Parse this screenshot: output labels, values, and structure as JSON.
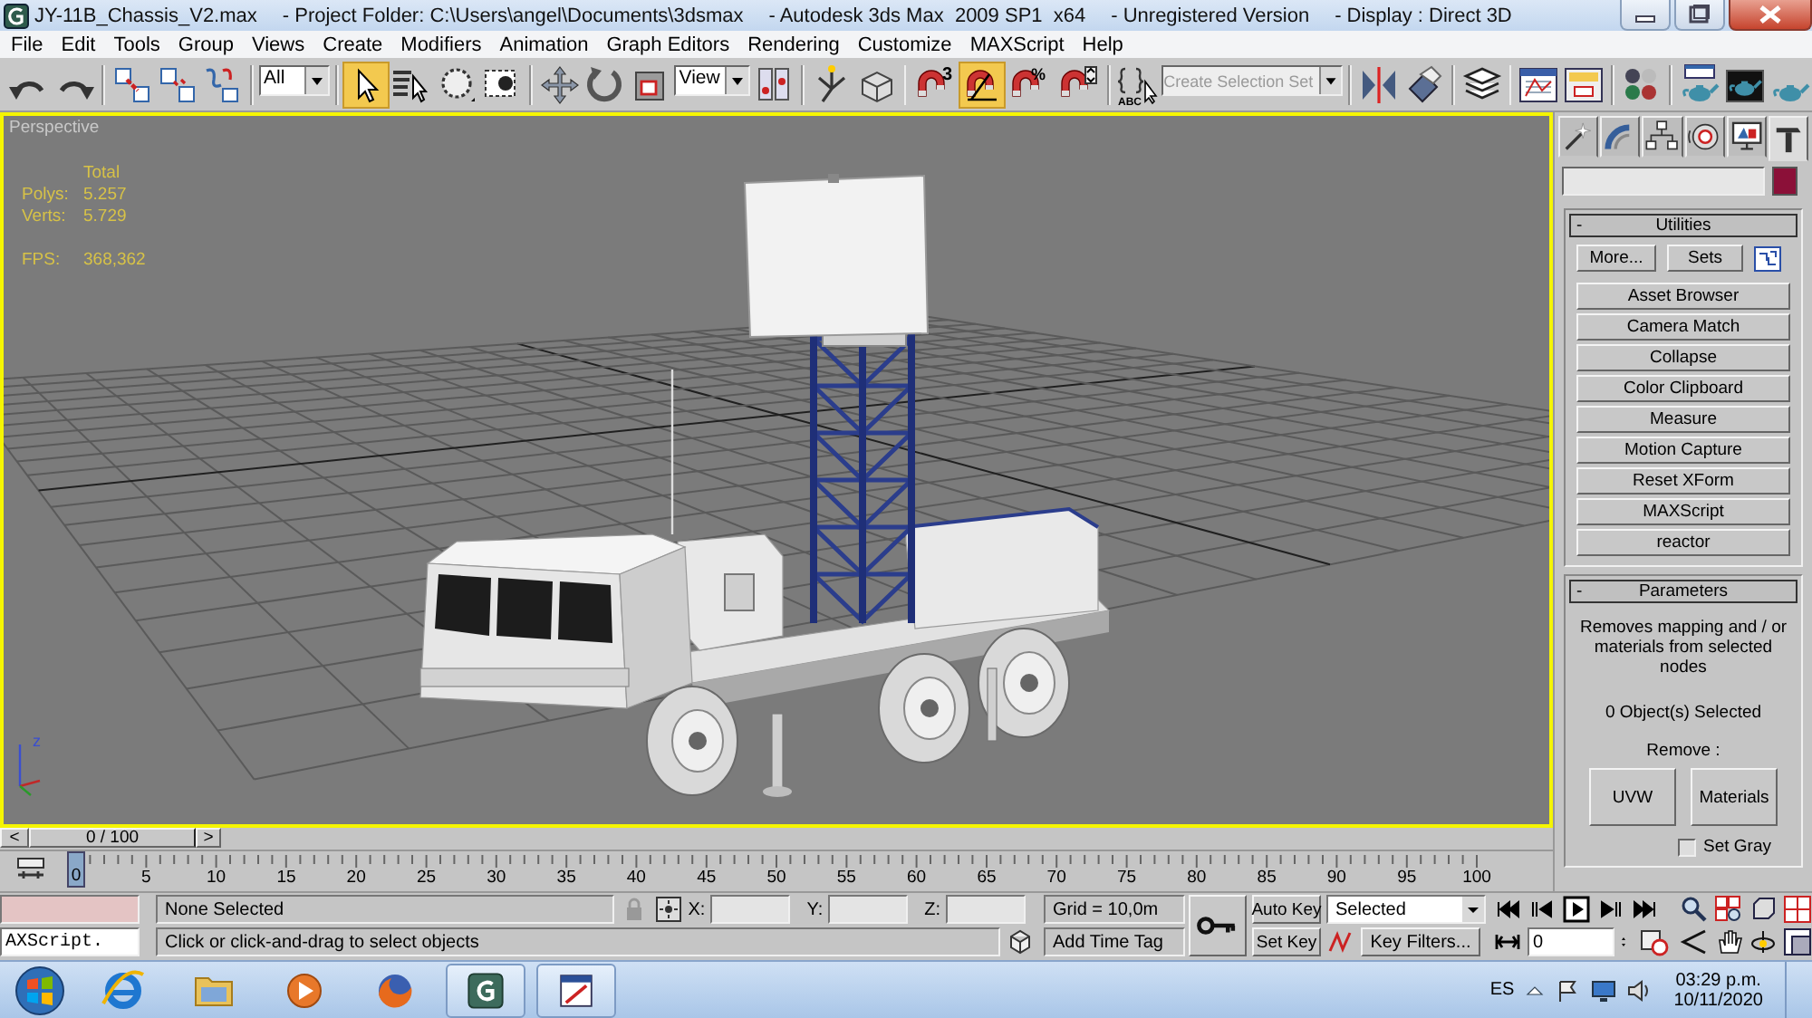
{
  "window": {
    "title_parts": [
      "JY-11B_Chassis_V2.max",
      "- Project Folder: C:\\Users\\angel\\Documents\\3dsmax",
      "- Autodesk 3ds Max  2009 SP1  x64",
      "- Unregistered Version",
      "- Display : Direct 3D"
    ]
  },
  "menu": [
    "File",
    "Edit",
    "Tools",
    "Group",
    "Views",
    "Create",
    "Modifiers",
    "Animation",
    "Graph Editors",
    "Rendering",
    "Customize",
    "MAXScript",
    "Help"
  ],
  "toolbar": {
    "selection_filter": "All",
    "select_object_on": true,
    "reference_coordinate_system": "View",
    "snap_dimension": "3",
    "angle_snap_on": true,
    "percent_label": "%",
    "named_sets_caption": "ABC",
    "named_selection_placeholder": "Create Selection Set"
  },
  "viewport": {
    "label": "Perspective",
    "active": true,
    "stats_heading": "Total",
    "stats": [
      {
        "label": "Polys:",
        "value": "5.257"
      },
      {
        "label": "Verts:",
        "value": "5.729"
      }
    ],
    "fps": {
      "label": "FPS:",
      "value": "368,362"
    },
    "axis_label": "z"
  },
  "command_panel": {
    "tabs": [
      {
        "selected": false
      },
      {
        "selected": false
      },
      {
        "selected": false
      },
      {
        "selected": false
      },
      {
        "selected": false
      },
      {
        "selected": true
      }
    ],
    "utilities": {
      "toggle": "-",
      "title": "Utilities",
      "top_buttons": [
        "More...",
        "Sets"
      ],
      "buttons": [
        "Asset Browser",
        "Camera Match",
        "Collapse",
        "Color Clipboard",
        "Measure",
        "Motion Capture",
        "Reset XForm",
        "MAXScript",
        "reactor"
      ]
    },
    "parameters": {
      "toggle": "-",
      "title": "Parameters",
      "description": "Removes mapping and / or materials from selected nodes",
      "selection_count": "0 Object(s) Selected",
      "remove_label": "Remove :",
      "remove_buttons": [
        "UVW",
        "Materials"
      ],
      "set_gray": {
        "label": "Set Gray",
        "checked": false
      }
    }
  },
  "time_slider": {
    "prev": "<",
    "position": "0 / 100",
    "next": ">"
  },
  "track_bar": {
    "current_frame": "0",
    "ticks": [
      "5",
      "10",
      "15",
      "20",
      "25",
      "30",
      "35",
      "40",
      "45",
      "50",
      "55",
      "60",
      "65",
      "70",
      "75",
      "80",
      "85",
      "90",
      "95",
      "100"
    ]
  },
  "status_bar": {
    "listener_input": "AXScript.",
    "selection": "None Selected",
    "coord_labels": [
      "X:",
      "Y:",
      "Z:"
    ],
    "grid": "Grid = 10,0m",
    "prompt": "Click or click-and-drag to select objects",
    "time_tag": "Add Time Tag",
    "auto_key": "Auto Key",
    "set_key": "Set Key",
    "key_mode": "Selected",
    "key_filters": "Key Filters...",
    "frame": "0"
  },
  "taskbar": {
    "language": "ES",
    "time": "03:29 p.m.",
    "date": "10/11/2020"
  }
}
